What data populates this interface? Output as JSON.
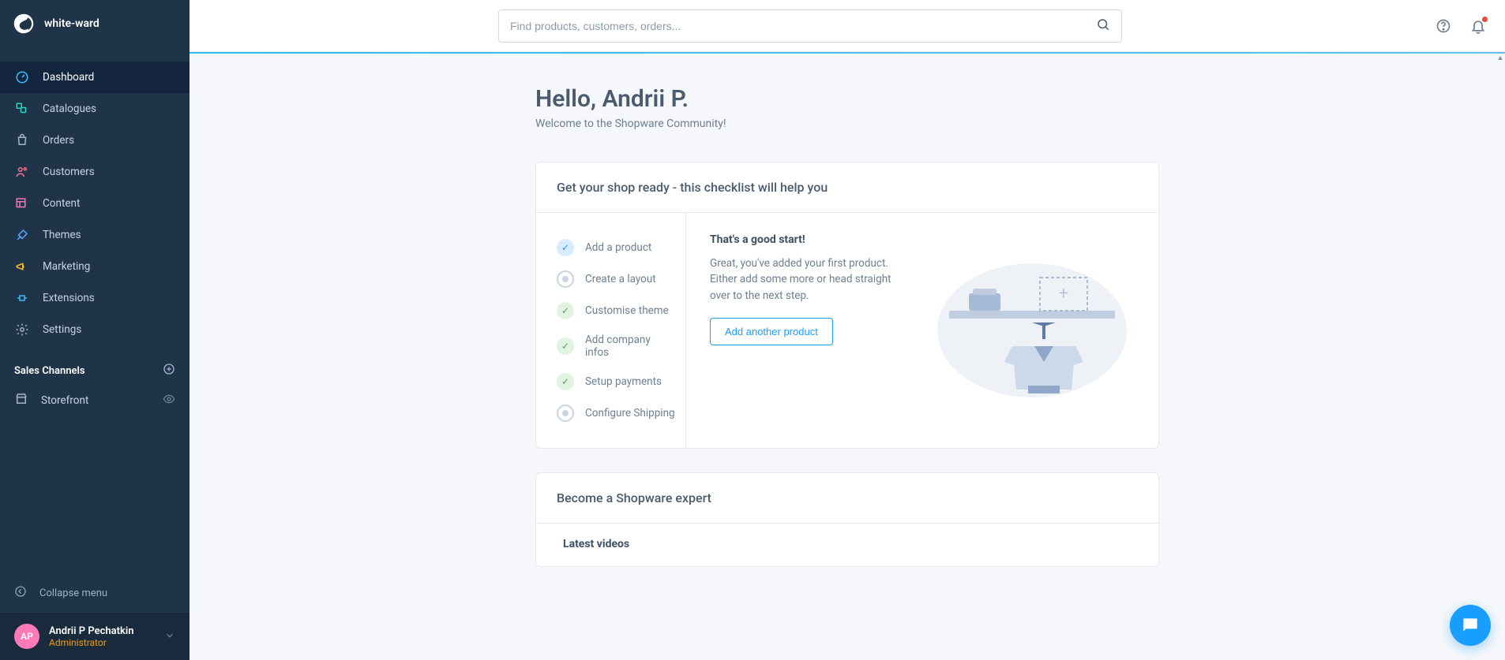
{
  "brand": {
    "name": "white-ward"
  },
  "nav": {
    "items": [
      {
        "label": "Dashboard"
      },
      {
        "label": "Catalogues"
      },
      {
        "label": "Orders"
      },
      {
        "label": "Customers"
      },
      {
        "label": "Content"
      },
      {
        "label": "Themes"
      },
      {
        "label": "Marketing"
      },
      {
        "label": "Extensions"
      },
      {
        "label": "Settings"
      }
    ],
    "sales_channels_title": "Sales Channels",
    "sales_channels": [
      {
        "label": "Storefront"
      }
    ],
    "collapse": "Collapse menu"
  },
  "user": {
    "initials": "AP",
    "name": "Andrii P Pechatkin",
    "role": "Administrator"
  },
  "search": {
    "placeholder": "Find products, customers, orders..."
  },
  "dashboard": {
    "greeting": "Hello, Andrii P.",
    "subgreeting": "Welcome to the Shopware Community!",
    "checklist": {
      "title": "Get your shop ready - this checklist will help you",
      "items": [
        {
          "label": "Add a product",
          "state": "blue"
        },
        {
          "label": "Create a layout",
          "state": "grey"
        },
        {
          "label": "Customise theme",
          "state": "green"
        },
        {
          "label": "Add company infos",
          "state": "green"
        },
        {
          "label": "Setup payments",
          "state": "green"
        },
        {
          "label": "Configure Shipping",
          "state": "grey"
        }
      ],
      "detail": {
        "title": "That's a good start!",
        "desc": "Great, you've added your first product. Either add some more or head straight over to the next step.",
        "cta": "Add another product"
      }
    },
    "expert_card": {
      "title": "Become a Shopware expert",
      "subtitle": "Latest videos"
    }
  }
}
